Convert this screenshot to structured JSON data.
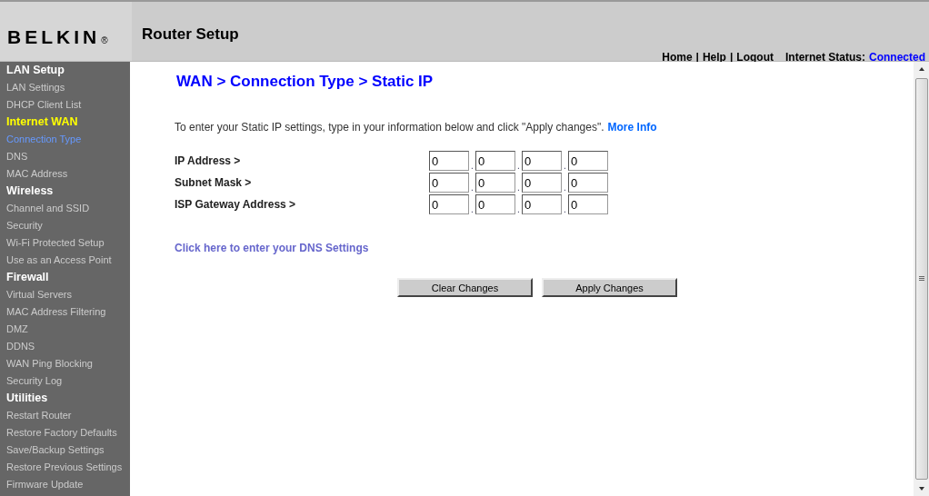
{
  "header": {
    "logo": "BELKIN",
    "logo_mark": "®",
    "title": "Router Setup",
    "nav": {
      "links": [
        "Home",
        "Help",
        "Logout"
      ],
      "separator": "|"
    },
    "status_label": "Internet Status:",
    "status_value": "Connected"
  },
  "sidebar": {
    "sections": [
      {
        "title": "LAN Setup",
        "selected": false,
        "items": [
          {
            "label": "LAN Settings",
            "selected": false
          },
          {
            "label": "DHCP Client List",
            "selected": false
          }
        ]
      },
      {
        "title": "Internet WAN",
        "selected": true,
        "items": [
          {
            "label": "Connection Type",
            "selected": true
          },
          {
            "label": "DNS",
            "selected": false
          },
          {
            "label": "MAC Address",
            "selected": false
          }
        ]
      },
      {
        "title": "Wireless",
        "selected": false,
        "items": [
          {
            "label": "Channel and SSID",
            "selected": false
          },
          {
            "label": "Security",
            "selected": false
          },
          {
            "label": "Wi-Fi Protected Setup",
            "selected": false
          },
          {
            "label": "Use as an Access Point",
            "selected": false
          }
        ]
      },
      {
        "title": "Firewall",
        "selected": false,
        "items": [
          {
            "label": "Virtual Servers",
            "selected": false
          },
          {
            "label": "MAC Address Filtering",
            "selected": false
          },
          {
            "label": "DMZ",
            "selected": false
          },
          {
            "label": "DDNS",
            "selected": false
          },
          {
            "label": "WAN Ping Blocking",
            "selected": false
          },
          {
            "label": "Security Log",
            "selected": false
          }
        ]
      },
      {
        "title": "Utilities",
        "selected": false,
        "items": [
          {
            "label": "Restart Router",
            "selected": false
          },
          {
            "label": "Restore Factory Defaults",
            "selected": false
          },
          {
            "label": "Save/Backup Settings",
            "selected": false
          },
          {
            "label": "Restore Previous Settings",
            "selected": false
          },
          {
            "label": "Firmware Update",
            "selected": false
          }
        ]
      }
    ]
  },
  "content": {
    "heading": "WAN > Connection Type > Static IP",
    "intro": "To enter your Static IP settings, type in your information below and click \"Apply changes\".",
    "more_info": "More Info",
    "separator": ".",
    "fields": [
      {
        "label": "IP Address >",
        "octets": [
          "0",
          "0",
          "0",
          "0"
        ]
      },
      {
        "label": "Subnet Mask >",
        "octets": [
          "0",
          "0",
          "0",
          "0"
        ]
      },
      {
        "label": "ISP Gateway Address >",
        "octets": [
          "0",
          "0",
          "0",
          "0"
        ]
      }
    ],
    "dns_link": "Click here to enter your DNS Settings",
    "buttons": [
      "Clear Changes",
      "Apply Changes"
    ]
  }
}
